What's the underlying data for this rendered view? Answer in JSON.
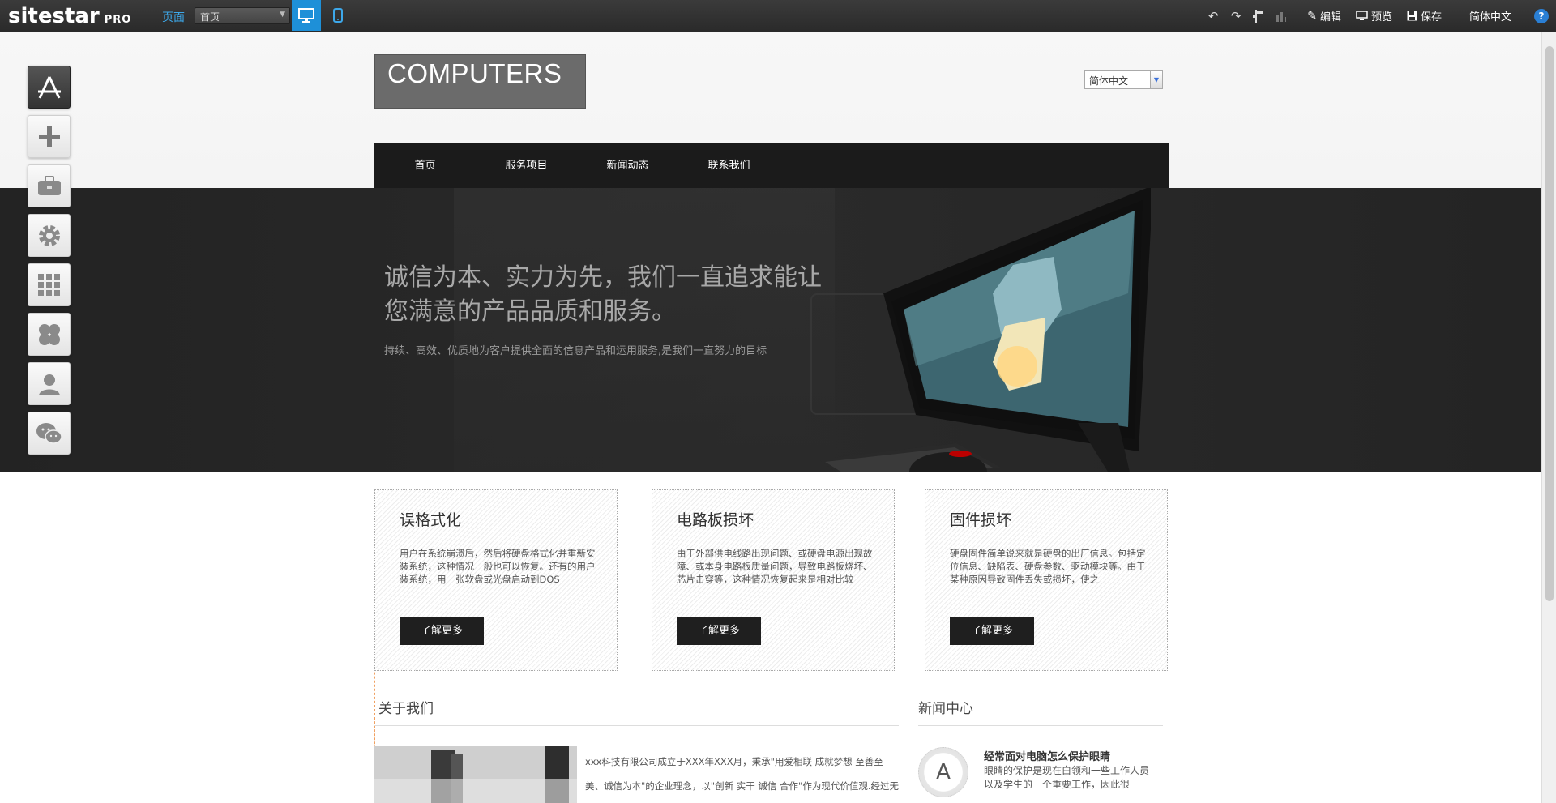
{
  "topbar": {
    "logo": "sitestar",
    "logo_suffix": "PRO",
    "page_label": "页面",
    "page_select_value": "首页",
    "actions": {
      "edit": "编辑",
      "preview": "预览",
      "save": "保存",
      "language": "简体中文",
      "help": "?"
    }
  },
  "site": {
    "logo_text": "COMPUTERS",
    "language_select": "简体中文",
    "nav": [
      "首页",
      "服务项目",
      "新闻动态",
      "联系我们"
    ]
  },
  "hero": {
    "title": "诚信为本、实力为先，我们一直追求能让您满意的产品品质和服务。",
    "subtitle": "持续、高效、优质地为客户提供全面的信息产品和运用服务,是我们一直努力的目标"
  },
  "features": [
    {
      "title": "误格式化",
      "text": "用户在系统崩溃后，然后将硬盘格式化并重新安装系统，这种情况一般也可以恢复。还有的用户装系统，用一张软盘或光盘启动到DOS",
      "button": "了解更多"
    },
    {
      "title": "电路板损坏",
      "text": "由于外部供电线路出现问题、或硬盘电源出现故障、或本身电路板质量问题，导致电路板烧坏、芯片击穿等，这种情况恢复起来是相对比较",
      "button": "了解更多"
    },
    {
      "title": "固件损坏",
      "text": "硬盘固件简单说来就是硬盘的出厂信息。包括定位信息、缺陷表、硬盘参数、驱动模块等。由于某种原因导致固件丢失或损坏，使之",
      "button": "了解更多"
    }
  ],
  "about": {
    "title": "关于我们",
    "text": "xxx科技有限公司成立于XXX年XXX月，秉承\"用爱相联 成就梦想 至善至美、诚信为本\"的企业理念，以\"创新 实干 诚信 合作\"作为现代价值观.经过无与伦比的努力发展，积累了丰富的管理经验和广泛的技术人才"
  },
  "news": {
    "title": "新闻中心",
    "avatar_letter": "A",
    "headline": "经常面对电脑怎么保护眼睛",
    "text": "眼睛的保护是现在白领和一些工作人员以及学生的一个重要工作，因此很"
  },
  "colors": {
    "accent": "#1e90d8",
    "nav_bg": "#1b1b1b",
    "hero_bg": "#252525"
  }
}
